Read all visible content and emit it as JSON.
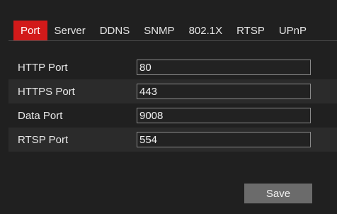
{
  "tabs": [
    {
      "label": "Port",
      "active": true
    },
    {
      "label": "Server",
      "active": false
    },
    {
      "label": "DDNS",
      "active": false
    },
    {
      "label": "SNMP",
      "active": false
    },
    {
      "label": "802.1X",
      "active": false
    },
    {
      "label": "RTSP",
      "active": false
    },
    {
      "label": "UPnP",
      "active": false
    }
  ],
  "form": {
    "rows": [
      {
        "label": "HTTP Port",
        "value": "80"
      },
      {
        "label": "HTTPS Port",
        "value": "443"
      },
      {
        "label": "Data Port",
        "value": "9008"
      },
      {
        "label": "RTSP Port",
        "value": "554"
      }
    ]
  },
  "actions": {
    "save_label": "Save"
  },
  "colors": {
    "background": "#202020",
    "active_tab": "#d21a1a",
    "button": "#6b6b6b"
  }
}
